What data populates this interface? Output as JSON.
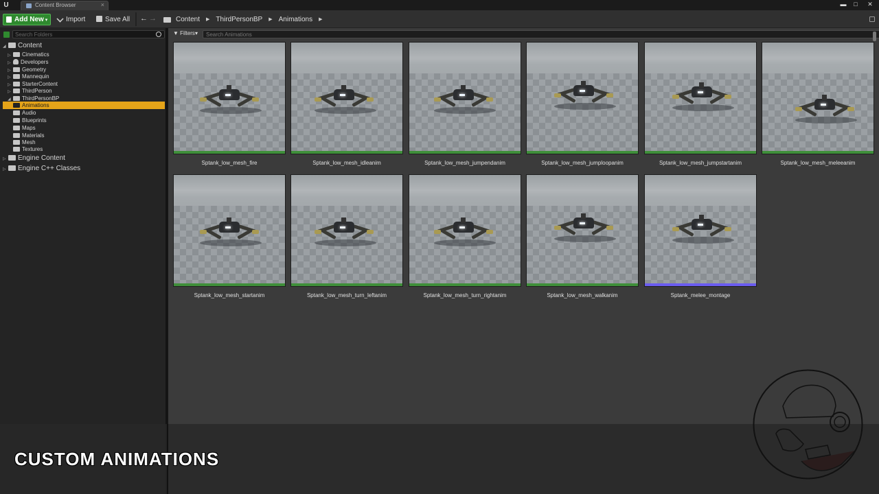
{
  "titlebar": {
    "tab_label": "Content Browser",
    "tab_close": "×",
    "logo_glyph": "U",
    "min_glyph": "▬",
    "max_glyph": "□",
    "close_glyph": "✕"
  },
  "toolbar": {
    "add_new_label": "Add New",
    "add_new_caret": "▾",
    "import_label": "Import",
    "save_all_label": "Save All",
    "back_glyph": "←",
    "forward_glyph": "→",
    "breadcrumb": [
      "Content",
      "ThirdPersonBP",
      "Animations"
    ],
    "breadcrumb_sep": "▶"
  },
  "sources": {
    "search_placeholder": "Search Folders",
    "tree": [
      {
        "label": "Content",
        "depth": 0,
        "expanded": true,
        "big": true
      },
      {
        "label": "Cinematics",
        "depth": 1
      },
      {
        "label": "Developers",
        "depth": 1,
        "icon": "user-icon"
      },
      {
        "label": "Geometry",
        "depth": 1
      },
      {
        "label": "Mannequin",
        "depth": 1
      },
      {
        "label": "StarterContent",
        "depth": 1
      },
      {
        "label": "ThirdPerson",
        "depth": 1
      },
      {
        "label": "ThirdPersonBP",
        "depth": 1,
        "expanded": true
      },
      {
        "label": "Animations",
        "depth": 2,
        "selected": true
      },
      {
        "label": "Audio",
        "depth": 2
      },
      {
        "label": "Blueprints",
        "depth": 2
      },
      {
        "label": "Maps",
        "depth": 2
      },
      {
        "label": "Materials",
        "depth": 2
      },
      {
        "label": "Mesh",
        "depth": 2
      },
      {
        "label": "Textures",
        "depth": 2
      },
      {
        "label": "Engine Content",
        "depth": 0,
        "big": true
      },
      {
        "label": "Engine C++ Classes",
        "depth": 0,
        "big": true
      }
    ]
  },
  "assets": {
    "filters_label": "Filters",
    "filters_caret": "▾",
    "search_placeholder": "Search Animations",
    "items": [
      {
        "name": "Sptank_low_mesh_fire",
        "kind": "animation"
      },
      {
        "name": "Sptank_low_mesh_idleanim",
        "kind": "animation"
      },
      {
        "name": "Sptank_low_mesh_jumpendanim",
        "kind": "animation"
      },
      {
        "name": "Sptank_low_mesh_jumploopanim",
        "kind": "animation"
      },
      {
        "name": "Sptank_low_mesh_jumpstartanim",
        "kind": "animation"
      },
      {
        "name": "Sptank_low_mesh_meleeanim",
        "kind": "animation"
      },
      {
        "name": "Sptank_low_mesh_startanim",
        "kind": "animation"
      },
      {
        "name": "Sptank_low_mesh_turn_leftanim",
        "kind": "animation"
      },
      {
        "name": "Sptank_low_mesh_turn_rightanim",
        "kind": "animation"
      },
      {
        "name": "Sptank_low_mesh_walkanim",
        "kind": "animation"
      },
      {
        "name": "Sptank_melee_montage",
        "kind": "montage"
      }
    ]
  },
  "colors": {
    "animation_stripe": "#3f8f3a",
    "montage_stripe": "#6a5cf0",
    "selection": "#e5a419",
    "add_new_green": "#2f8a2f"
  },
  "overlay": {
    "title": "CUSTOM ANIMATIONS"
  }
}
